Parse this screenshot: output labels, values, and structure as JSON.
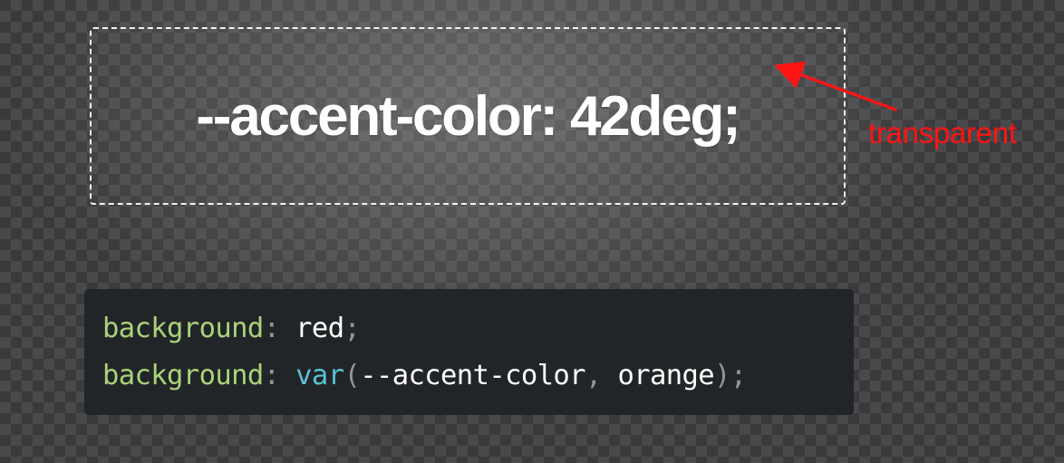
{
  "demo": {
    "text": "--accent-color: 42deg;"
  },
  "annotation": {
    "label": "transparent",
    "color": "#ff1414"
  },
  "code": {
    "line1": {
      "property": "background",
      "colon": ":",
      "value": "red",
      "semicolon": ";"
    },
    "line2": {
      "property": "background",
      "colon": ":",
      "func": "var",
      "open_paren": "(",
      "arg1": "--accent-color",
      "comma": ",",
      "arg2": "orange",
      "close_paren": ")",
      "semicolon": ";"
    }
  },
  "colors": {
    "property": "#a9d37a",
    "punctuation": "#8e969c",
    "value": "#ffffff",
    "function": "#5cc1d6",
    "code_background": "#222527"
  }
}
